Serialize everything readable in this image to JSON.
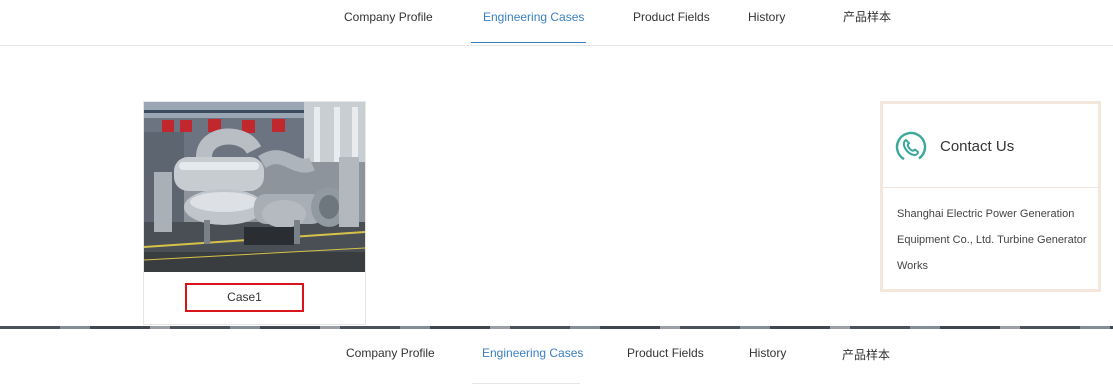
{
  "nav": {
    "items": [
      {
        "label": "Company Profile"
      },
      {
        "label": "Engineering Cases"
      },
      {
        "label": "Product Fields"
      },
      {
        "label": "History"
      },
      {
        "label": "产品样本"
      }
    ],
    "active_index": 1
  },
  "case": {
    "label": "Case1"
  },
  "contact": {
    "title": "Contact Us",
    "icon": "phone-icon",
    "lines": [
      "Shanghai Electric Power Generation",
      "Equipment Co., Ltd. Turbine Generator",
      "Works"
    ]
  },
  "bottom_nav": {
    "items": [
      {
        "label": "Company Profile"
      },
      {
        "label": "Engineering Cases"
      },
      {
        "label": "Product Fields"
      },
      {
        "label": "History"
      },
      {
        "label": "产品样本"
      }
    ]
  },
  "colors": {
    "accent": "#3b7fbf",
    "case_border": "#d9141b",
    "contact_border": "#f3e7dc",
    "icon_teal": "#3aa89a"
  }
}
